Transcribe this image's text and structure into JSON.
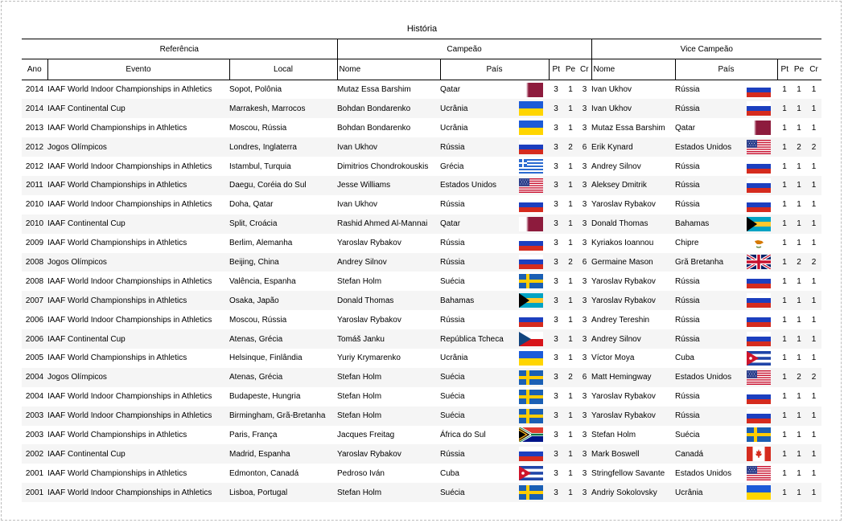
{
  "title": "História",
  "groups": {
    "ref": "Referência",
    "champ": "Campeão",
    "vice": "Vice Campeão"
  },
  "columns": {
    "ano": "Ano",
    "evento": "Evento",
    "local": "Local",
    "c_nome": "Nome",
    "c_pais": "País",
    "c_pt": "Pt",
    "c_pe": "Pe",
    "c_cr": "Cr",
    "v_nome": "Nome",
    "v_pais": "País",
    "v_pt": "Pt",
    "v_pe": "Pe",
    "v_cr": "Cr"
  },
  "flag_icons": {
    "Qatar": "qatar-flag-icon",
    "Rússia": "russia-flag-icon",
    "Ucrânia": "ukraine-flag-icon",
    "Grécia": "greece-flag-icon",
    "Estados Unidos": "usa-flag-icon",
    "Bahamas": "bahamas-flag-icon",
    "Chipre": "cyprus-flag-icon",
    "Grã Bretanha": "uk-flag-icon",
    "Suécia": "sweden-flag-icon",
    "República Tcheca": "czech-flag-icon",
    "Cuba": "cuba-flag-icon",
    "África do Sul": "south-africa-flag-icon",
    "Canadá": "canada-flag-icon"
  },
  "rows": [
    {
      "ano": "2014",
      "evento": "IAAF World Indoor Championships in Athletics",
      "local": "Sopot, Polônia",
      "c_nome": "Mutaz Essa Barshim",
      "c_pais": "Qatar",
      "c_pt": "3",
      "c_pe": "1",
      "c_cr": "3",
      "v_nome": "Ivan Ukhov",
      "v_pais": "Rússia",
      "v_pt": "1",
      "v_pe": "1",
      "v_cr": "1"
    },
    {
      "ano": "2014",
      "evento": "IAAF Continental Cup",
      "local": "Marrakesh, Marrocos",
      "c_nome": "Bohdan Bondarenko",
      "c_pais": "Ucrânia",
      "c_pt": "3",
      "c_pe": "1",
      "c_cr": "3",
      "v_nome": "Ivan Ukhov",
      "v_pais": "Rússia",
      "v_pt": "1",
      "v_pe": "1",
      "v_cr": "1"
    },
    {
      "ano": "2013",
      "evento": "IAAF World Championships in Athletics",
      "local": "Moscou, Rússia",
      "c_nome": "Bohdan Bondarenko",
      "c_pais": "Ucrânia",
      "c_pt": "3",
      "c_pe": "1",
      "c_cr": "3",
      "v_nome": "Mutaz Essa Barshim",
      "v_pais": "Qatar",
      "v_pt": "1",
      "v_pe": "1",
      "v_cr": "1"
    },
    {
      "ano": "2012",
      "evento": "Jogos Olímpicos",
      "local": "Londres, Inglaterra",
      "c_nome": "Ivan Ukhov",
      "c_pais": "Rússia",
      "c_pt": "3",
      "c_pe": "2",
      "c_cr": "6",
      "v_nome": "Erik Kynard",
      "v_pais": "Estados Unidos",
      "v_pt": "1",
      "v_pe": "2",
      "v_cr": "2"
    },
    {
      "ano": "2012",
      "evento": "IAAF World Indoor Championships in Athletics",
      "local": "Istambul, Turquia",
      "c_nome": "Dimitrios Chondrokouskis",
      "c_pais": "Grécia",
      "c_pt": "3",
      "c_pe": "1",
      "c_cr": "3",
      "v_nome": "Andrey Silnov",
      "v_pais": "Rússia",
      "v_pt": "1",
      "v_pe": "1",
      "v_cr": "1"
    },
    {
      "ano": "2011",
      "evento": "IAAF World Championships in Athletics",
      "local": "Daegu, Coréia do Sul",
      "c_nome": "Jesse Williams",
      "c_pais": "Estados Unidos",
      "c_pt": "3",
      "c_pe": "1",
      "c_cr": "3",
      "v_nome": "Aleksey Dmitrik",
      "v_pais": "Rússia",
      "v_pt": "1",
      "v_pe": "1",
      "v_cr": "1"
    },
    {
      "ano": "2010",
      "evento": "IAAF World Indoor Championships in Athletics",
      "local": "Doha, Qatar",
      "c_nome": "Ivan Ukhov",
      "c_pais": "Rússia",
      "c_pt": "3",
      "c_pe": "1",
      "c_cr": "3",
      "v_nome": "Yaroslav Rybakov",
      "v_pais": "Rússia",
      "v_pt": "1",
      "v_pe": "1",
      "v_cr": "1"
    },
    {
      "ano": "2010",
      "evento": "IAAF Continental Cup",
      "local": "Split, Croácia",
      "c_nome": "Rashid Ahmed Al-Mannai",
      "c_pais": "Qatar",
      "c_pt": "3",
      "c_pe": "1",
      "c_cr": "3",
      "v_nome": "Donald Thomas",
      "v_pais": "Bahamas",
      "v_pt": "1",
      "v_pe": "1",
      "v_cr": "1"
    },
    {
      "ano": "2009",
      "evento": "IAAF World Championships in Athletics",
      "local": "Berlim, Alemanha",
      "c_nome": "Yaroslav Rybakov",
      "c_pais": "Rússia",
      "c_pt": "3",
      "c_pe": "1",
      "c_cr": "3",
      "v_nome": "Kyriakos Ioannou",
      "v_pais": "Chipre",
      "v_pt": "1",
      "v_pe": "1",
      "v_cr": "1"
    },
    {
      "ano": "2008",
      "evento": "Jogos Olímpicos",
      "local": "Beijing, China",
      "c_nome": "Andrey Silnov",
      "c_pais": "Rússia",
      "c_pt": "3",
      "c_pe": "2",
      "c_cr": "6",
      "v_nome": "Germaine Mason",
      "v_pais": "Grã Bretanha",
      "v_pt": "1",
      "v_pe": "2",
      "v_cr": "2"
    },
    {
      "ano": "2008",
      "evento": "IAAF World Indoor Championships in Athletics",
      "local": "Valência, Espanha",
      "c_nome": "Stefan Holm",
      "c_pais": "Suécia",
      "c_pt": "3",
      "c_pe": "1",
      "c_cr": "3",
      "v_nome": "Yaroslav Rybakov",
      "v_pais": "Rússia",
      "v_pt": "1",
      "v_pe": "1",
      "v_cr": "1"
    },
    {
      "ano": "2007",
      "evento": "IAAF World Championships in Athletics",
      "local": "Osaka, Japão",
      "c_nome": "Donald Thomas",
      "c_pais": "Bahamas",
      "c_pt": "3",
      "c_pe": "1",
      "c_cr": "3",
      "v_nome": "Yaroslav Rybakov",
      "v_pais": "Rússia",
      "v_pt": "1",
      "v_pe": "1",
      "v_cr": "1"
    },
    {
      "ano": "2006",
      "evento": "IAAF World Indoor Championships in Athletics",
      "local": "Moscou, Rússia",
      "c_nome": "Yaroslav Rybakov",
      "c_pais": "Rússia",
      "c_pt": "3",
      "c_pe": "1",
      "c_cr": "3",
      "v_nome": "Andrey Tereshin",
      "v_pais": "Rússia",
      "v_pt": "1",
      "v_pe": "1",
      "v_cr": "1"
    },
    {
      "ano": "2006",
      "evento": "IAAF Continental Cup",
      "local": "Atenas, Grécia",
      "c_nome": "Tomáš Janku",
      "c_pais": "República Tcheca",
      "c_pt": "3",
      "c_pe": "1",
      "c_cr": "3",
      "v_nome": "Andrey Silnov",
      "v_pais": "Rússia",
      "v_pt": "1",
      "v_pe": "1",
      "v_cr": "1"
    },
    {
      "ano": "2005",
      "evento": "IAAF World Championships in Athletics",
      "local": "Helsinque, Finlândia",
      "c_nome": "Yuriy Krymarenko",
      "c_pais": "Ucrânia",
      "c_pt": "3",
      "c_pe": "1",
      "c_cr": "3",
      "v_nome": "Víctor Moya",
      "v_pais": "Cuba",
      "v_pt": "1",
      "v_pe": "1",
      "v_cr": "1"
    },
    {
      "ano": "2004",
      "evento": "Jogos Olímpicos",
      "local": "Atenas, Grécia",
      "c_nome": "Stefan Holm",
      "c_pais": "Suécia",
      "c_pt": "3",
      "c_pe": "2",
      "c_cr": "6",
      "v_nome": "Matt Hemingway",
      "v_pais": "Estados Unidos",
      "v_pt": "1",
      "v_pe": "2",
      "v_cr": "2"
    },
    {
      "ano": "2004",
      "evento": "IAAF World Indoor Championships in Athletics",
      "local": "Budapeste, Hungria",
      "c_nome": "Stefan Holm",
      "c_pais": "Suécia",
      "c_pt": "3",
      "c_pe": "1",
      "c_cr": "3",
      "v_nome": "Yaroslav Rybakov",
      "v_pais": "Rússia",
      "v_pt": "1",
      "v_pe": "1",
      "v_cr": "1"
    },
    {
      "ano": "2003",
      "evento": "IAAF World Indoor Championships in Athletics",
      "local": "Birmingham, Grã-Bretanha",
      "c_nome": "Stefan Holm",
      "c_pais": "Suécia",
      "c_pt": "3",
      "c_pe": "1",
      "c_cr": "3",
      "v_nome": "Yaroslav Rybakov",
      "v_pais": "Rússia",
      "v_pt": "1",
      "v_pe": "1",
      "v_cr": "1"
    },
    {
      "ano": "2003",
      "evento": "IAAF World Championships in Athletics",
      "local": "Paris, França",
      "c_nome": "Jacques Freitag",
      "c_pais": "África do Sul",
      "c_pt": "3",
      "c_pe": "1",
      "c_cr": "3",
      "v_nome": "Stefan Holm",
      "v_pais": "Suécia",
      "v_pt": "1",
      "v_pe": "1",
      "v_cr": "1"
    },
    {
      "ano": "2002",
      "evento": "IAAF Continental Cup",
      "local": "Madrid, Espanha",
      "c_nome": "Yaroslav Rybakov",
      "c_pais": "Rússia",
      "c_pt": "3",
      "c_pe": "1",
      "c_cr": "3",
      "v_nome": "Mark Boswell",
      "v_pais": "Canadá",
      "v_pt": "1",
      "v_pe": "1",
      "v_cr": "1"
    },
    {
      "ano": "2001",
      "evento": "IAAF World Championships in Athletics",
      "local": "Edmonton, Canadá",
      "c_nome": "Pedroso Iván",
      "c_pais": "Cuba",
      "c_pt": "3",
      "c_pe": "1",
      "c_cr": "3",
      "v_nome": "Stringfellow Savante",
      "v_pais": "Estados Unidos",
      "v_pt": "1",
      "v_pe": "1",
      "v_cr": "1"
    },
    {
      "ano": "2001",
      "evento": "IAAF World Indoor Championships in Athletics",
      "local": "Lisboa, Portugal",
      "c_nome": "Stefan Holm",
      "c_pais": "Suécia",
      "c_pt": "3",
      "c_pe": "1",
      "c_cr": "3",
      "v_nome": "Andriy Sokolovsky",
      "v_pais": "Ucrânia",
      "v_pt": "1",
      "v_pe": "1",
      "v_cr": "1"
    }
  ]
}
